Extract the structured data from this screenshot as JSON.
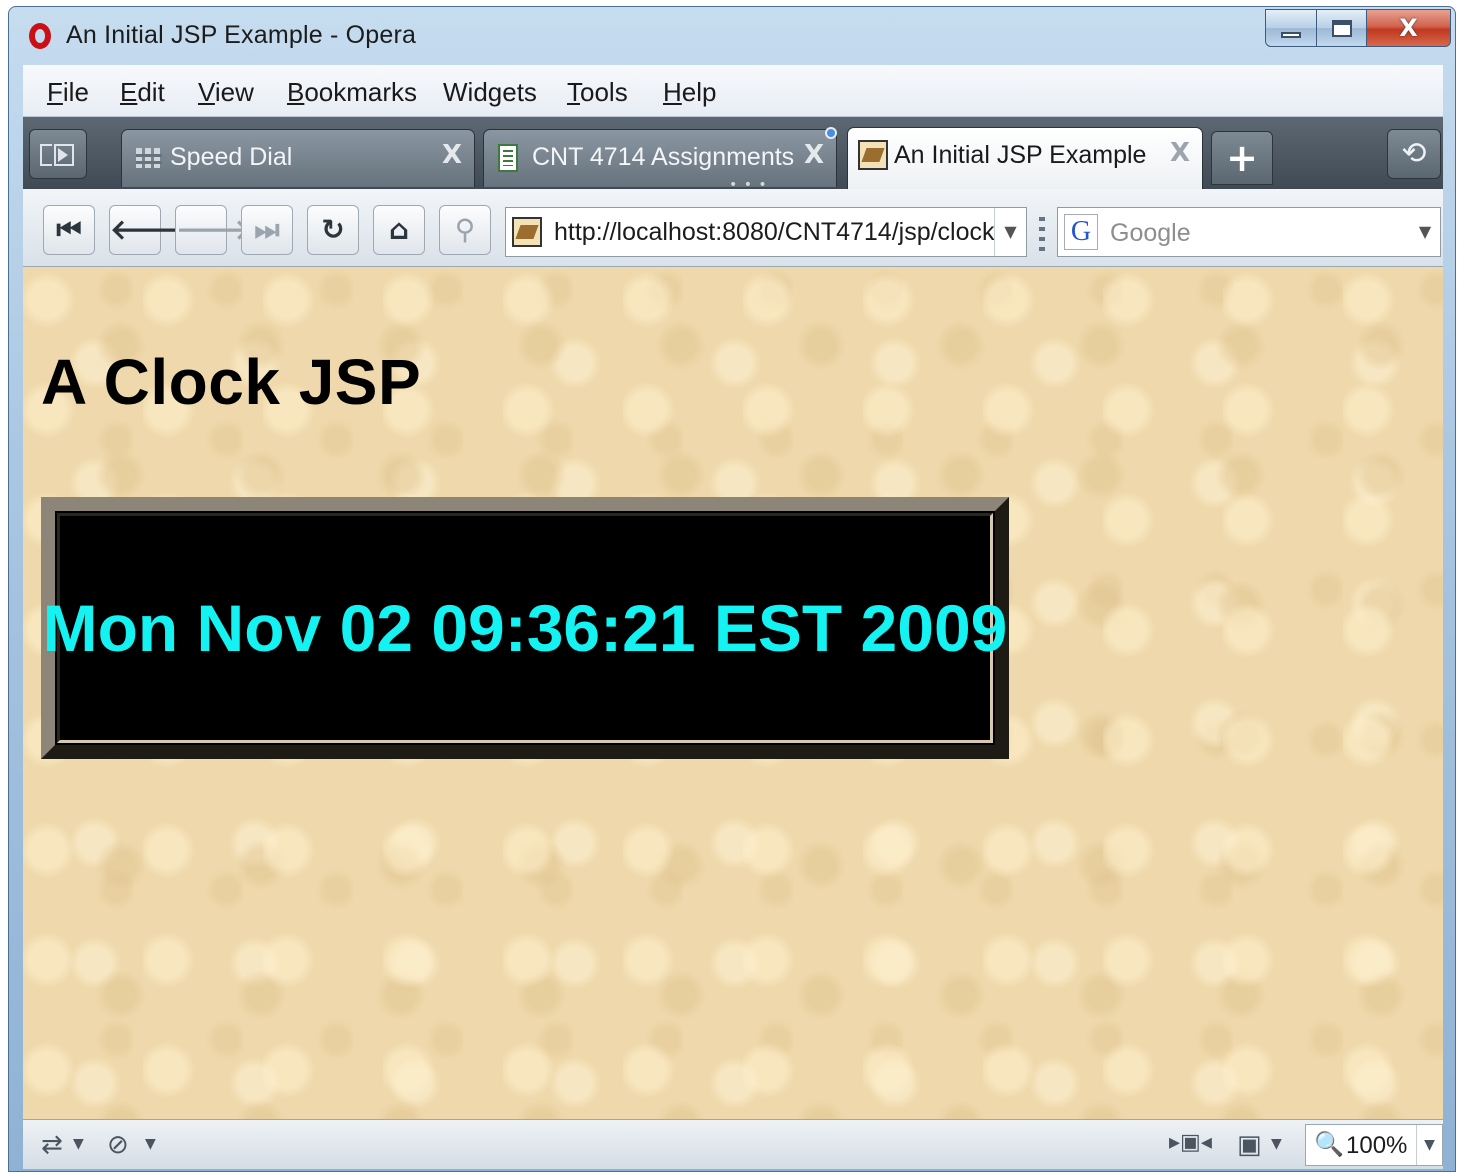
{
  "window": {
    "title": "An Initial JSP Example - Opera",
    "controls": {
      "minimize": "–",
      "maximize": "□",
      "close": "X"
    }
  },
  "menubar": {
    "items": [
      {
        "label": "File",
        "accel": "F",
        "rest": "ile"
      },
      {
        "label": "Edit",
        "accel": "E",
        "rest": "dit"
      },
      {
        "label": "View",
        "accel": "V",
        "rest": "iew"
      },
      {
        "label": "Bookmarks",
        "accel": "B",
        "rest": "ookmarks"
      },
      {
        "label": "Widgets",
        "accel": "",
        "rest": "Widgets"
      },
      {
        "label": "Tools",
        "accel": "T",
        "rest": "ools"
      },
      {
        "label": "Help",
        "accel": "H",
        "rest": "elp"
      }
    ]
  },
  "tabs": {
    "items": [
      {
        "label": "Speed Dial",
        "icon": "speed-dial-icon",
        "close": "X",
        "active": false
      },
      {
        "label": "CNT 4714 Assignments",
        "icon": "document-icon",
        "close": "X",
        "active": false
      },
      {
        "label": "An Initial JSP Example",
        "icon": "page-favicon-icon",
        "close": "X",
        "active": true
      }
    ],
    "new_tab": "+",
    "trash": "⟲",
    "overflow": "• • •"
  },
  "navigation": {
    "buttons": [
      {
        "name": "rewind-button",
        "glyph": "⏮",
        "enabled": true
      },
      {
        "name": "back-button",
        "glyph": "🡐",
        "enabled": true
      },
      {
        "name": "forward-button",
        "glyph": "🡒",
        "enabled": false
      },
      {
        "name": "fast-forward-button",
        "glyph": "⏭",
        "enabled": false
      },
      {
        "name": "reload-button",
        "glyph": "↻",
        "enabled": true
      },
      {
        "name": "home-button",
        "glyph": "⌂",
        "enabled": true
      },
      {
        "name": "wand-button",
        "glyph": "⚲",
        "enabled": false
      }
    ],
    "address": "http://localhost:8080/CNT4714/jsp/clock",
    "address_dropdown": "▼",
    "search_engine": "G",
    "search_placeholder": "Google",
    "search_dropdown": "▼"
  },
  "content": {
    "heading": "A Clock JSP",
    "clock_text": "Mon Nov 02 09:36:21 EST 2009",
    "clock_color": "#14f2f2",
    "clock_background": "#000000"
  },
  "statusbar": {
    "left_icons": [
      {
        "name": "transfer-icon",
        "glyph": "⇄"
      },
      {
        "name": "content-blocker-icon",
        "glyph": "⊘"
      }
    ],
    "right_icons": [
      {
        "name": "presentation-mode-icon",
        "glyph": "▸▣◂"
      },
      {
        "name": "view-icon",
        "glyph": "▣"
      }
    ],
    "dropdown": "▼",
    "zoom_icon": "🔍",
    "zoom": "100%",
    "zoom_dropdown": "▼"
  }
}
